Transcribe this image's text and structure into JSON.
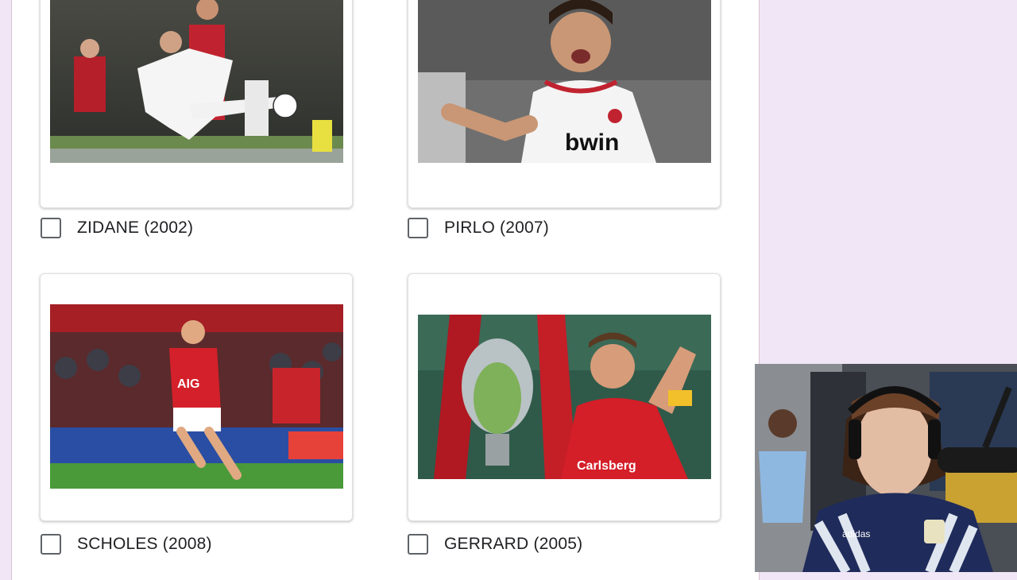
{
  "options": [
    {
      "label": "ZIDANE (2002)",
      "image_icon": "zidane-photo"
    },
    {
      "label": "PIRLO (2007)",
      "image_icon": "pirlo-photo"
    },
    {
      "label": "SCHOLES (2008)",
      "image_icon": "scholes-photo"
    },
    {
      "label": "GERRARD (2005)",
      "image_icon": "gerrard-photo"
    }
  ],
  "photo_text": {
    "pirlo_sponsor": "bwin",
    "scholes_sponsor": "AIG",
    "gerrard_sponsor": "Carlsberg",
    "webcam_shirt_brand": "adidas"
  },
  "colors": {
    "page_background": "#f0e6f6",
    "card_background": "#ffffff",
    "checkbox_border": "#5f6368",
    "label_text": "#202124"
  }
}
